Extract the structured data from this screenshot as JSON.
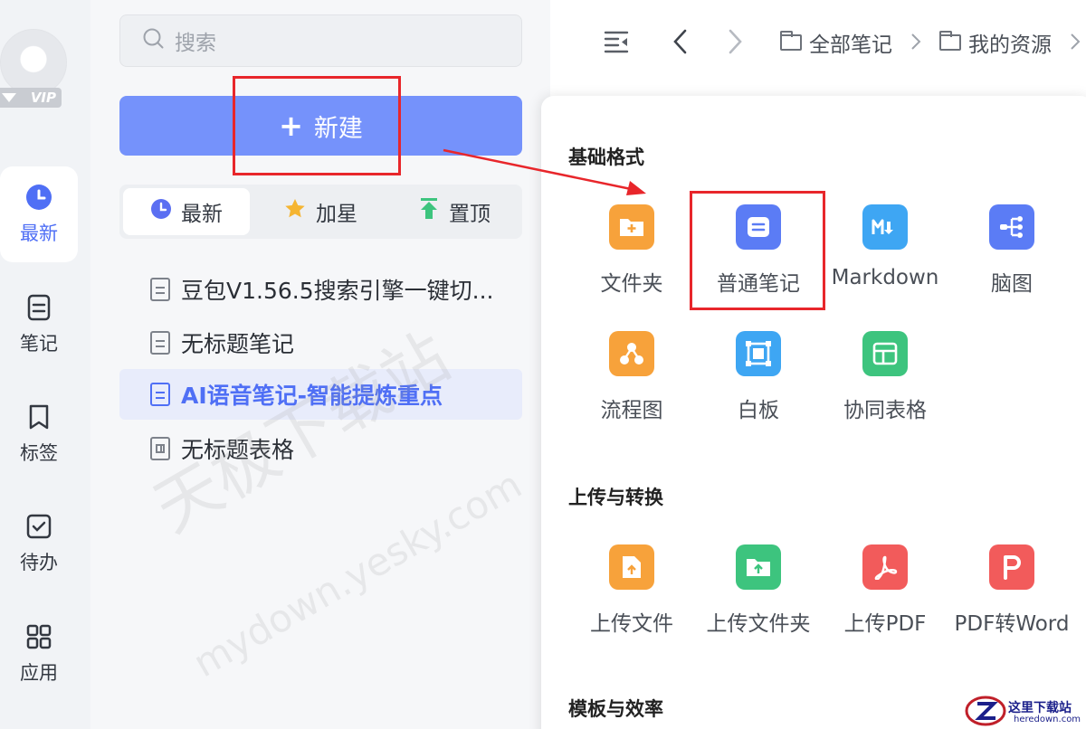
{
  "rail": {
    "vip": "VIP",
    "items": [
      {
        "label": "最新"
      },
      {
        "label": "笔记"
      },
      {
        "label": "标签"
      },
      {
        "label": "待办"
      },
      {
        "label": "应用"
      }
    ]
  },
  "search": {
    "placeholder": "搜索"
  },
  "new_button": {
    "label": "新建"
  },
  "tabs": [
    {
      "label": "最新"
    },
    {
      "label": "加星"
    },
    {
      "label": "置顶"
    }
  ],
  "notes": [
    {
      "title": "豆包V1.56.5搜索引擎一键切..."
    },
    {
      "title": "无标题笔记"
    },
    {
      "title": "AI语音笔记-智能提炼重点"
    },
    {
      "title": "无标题表格"
    }
  ],
  "breadcrumb": [
    {
      "label": "全部笔记"
    },
    {
      "label": "我的资源"
    }
  ],
  "panel": {
    "sections": [
      {
        "title": "基础格式",
        "items": [
          {
            "label": "文件夹",
            "icon": "folder-plus-icon",
            "color": "#f7a23b"
          },
          {
            "label": "普通笔记",
            "icon": "note-icon",
            "color": "#5b7cf5"
          },
          {
            "label": "Markdown",
            "icon": "markdown-icon",
            "color": "#3ea6f3"
          },
          {
            "label": "脑图",
            "icon": "mindmap-icon",
            "color": "#5b7cf5"
          },
          {
            "label": "流程图",
            "icon": "flowchart-icon",
            "color": "#f7a23b"
          },
          {
            "label": "白板",
            "icon": "whiteboard-icon",
            "color": "#3ea6f3"
          },
          {
            "label": "协同表格",
            "icon": "table-icon",
            "color": "#3dc47e"
          }
        ]
      },
      {
        "title": "上传与转换",
        "items": [
          {
            "label": "上传文件",
            "icon": "upload-file-icon",
            "color": "#f7a23b"
          },
          {
            "label": "上传文件夹",
            "icon": "upload-folder-icon",
            "color": "#3dc47e"
          },
          {
            "label": "上传PDF",
            "icon": "pdf-icon",
            "color": "#f25b5b"
          },
          {
            "label": "PDF转Word",
            "icon": "pdf-to-word-icon",
            "color": "#f25b5b"
          }
        ]
      },
      {
        "title": "模板与效率",
        "items": []
      }
    ]
  },
  "watermark": {
    "line1": "天极下载站",
    "line2": "mydown.yesky.com"
  },
  "site_logo": {
    "line1": "这里下载站",
    "line2": "heredown.com"
  },
  "colors": {
    "accent": "#4f6ff5",
    "new_button": "#7592fb",
    "annotation": "#e8262b"
  }
}
